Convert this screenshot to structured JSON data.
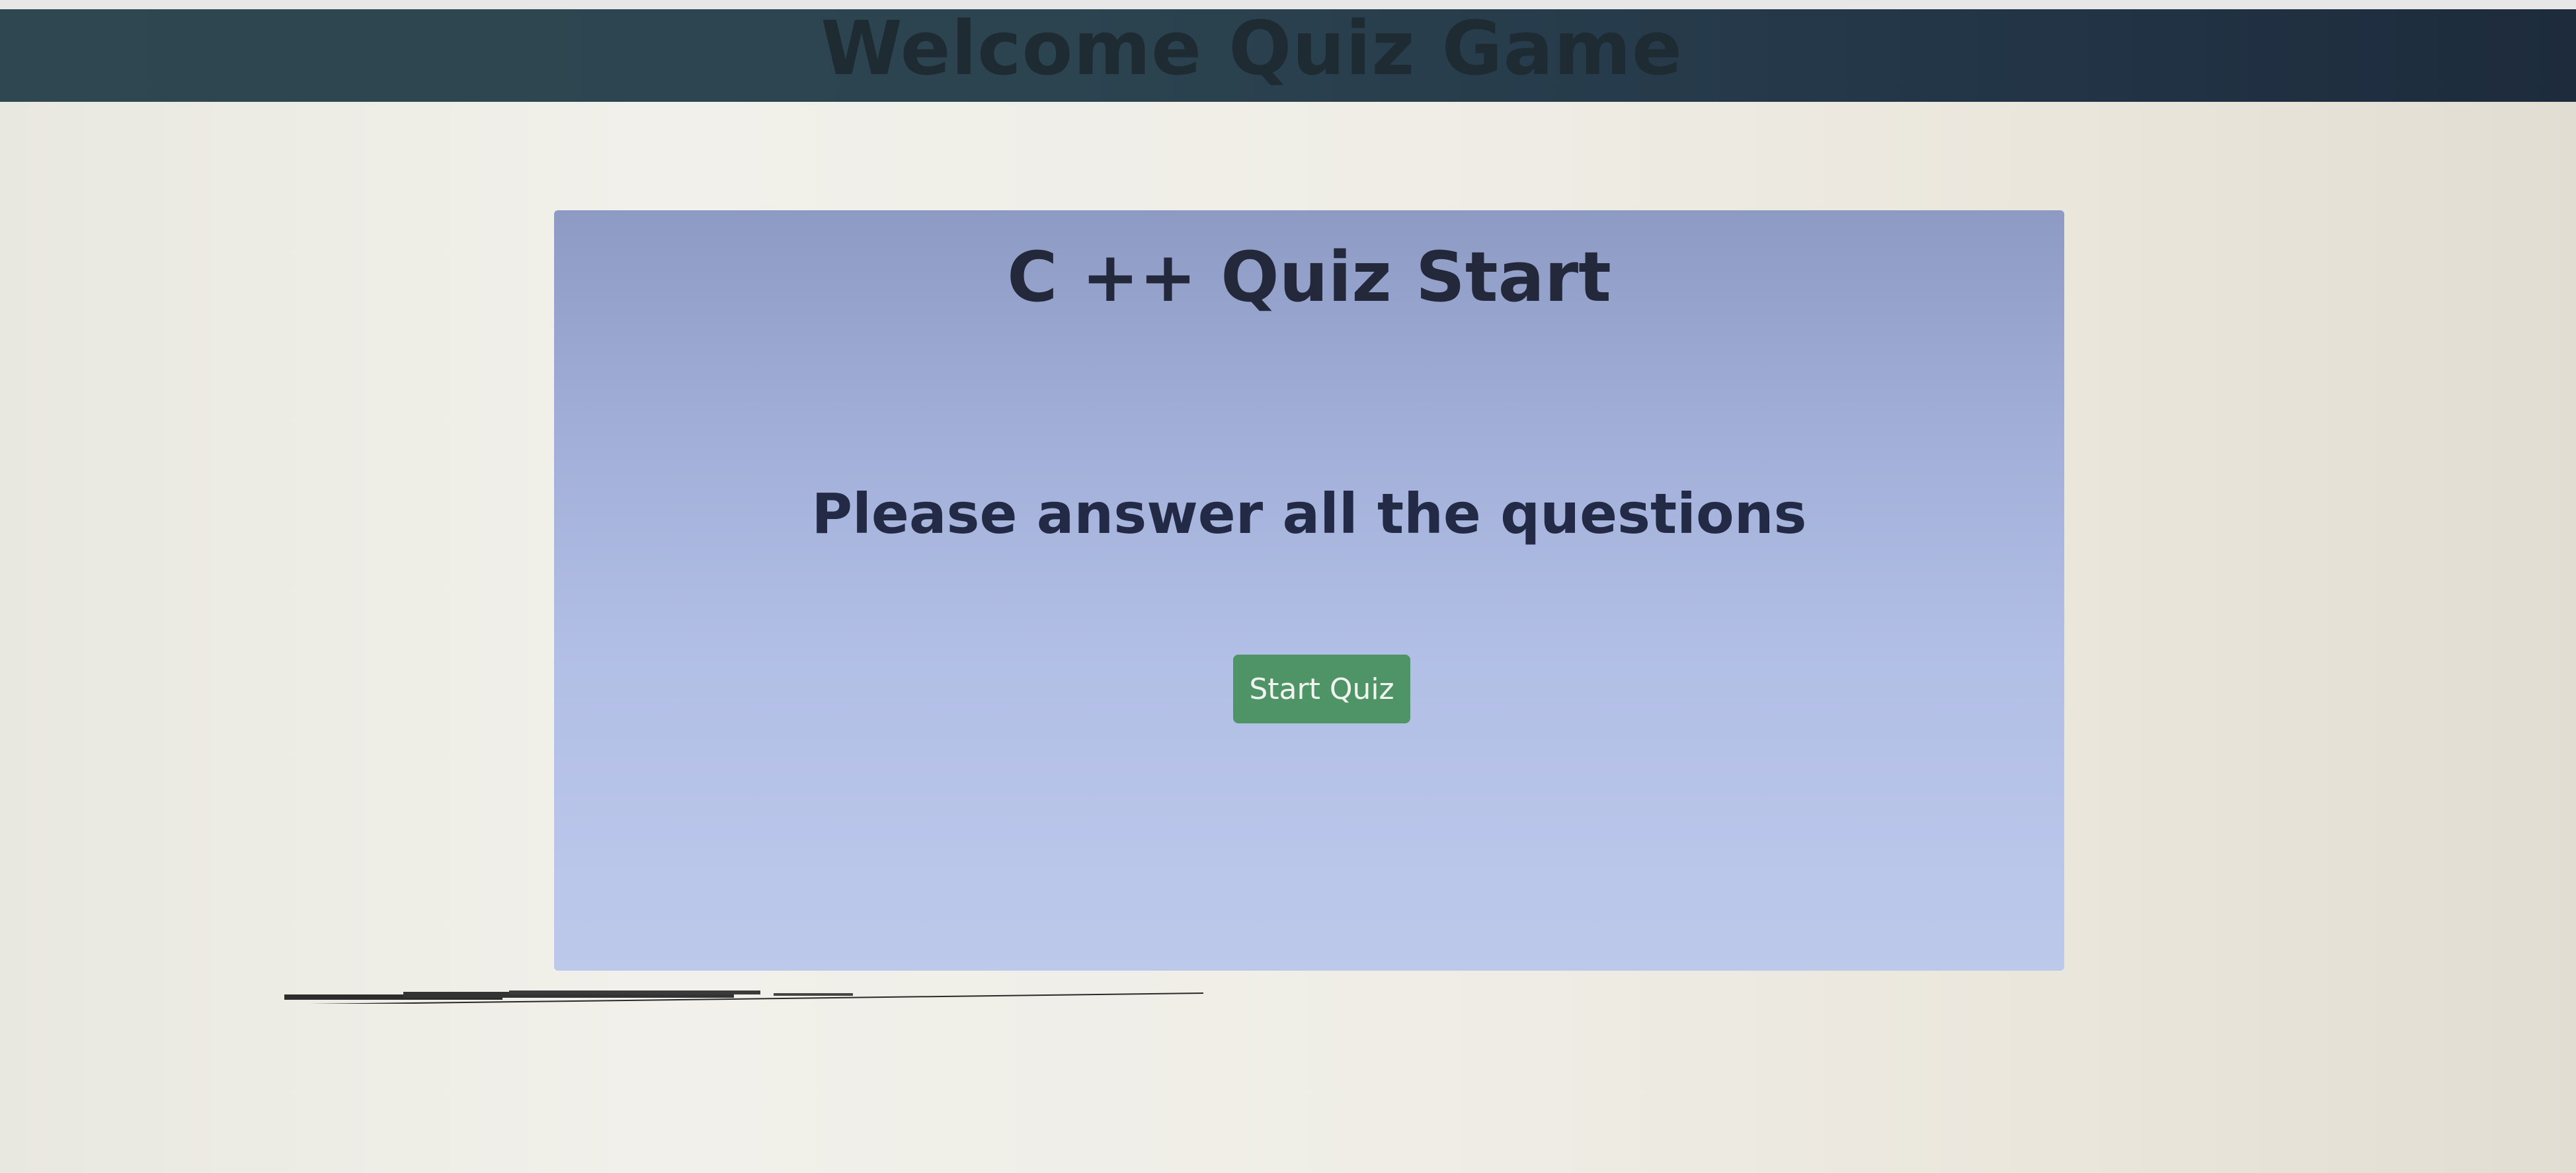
{
  "header": {
    "title": "Welcome Quiz Game",
    "background": "#2c4450"
  },
  "quiz_card": {
    "title": "C ++ Quiz Start",
    "instructions": "Please answer all the questions",
    "start_button_label": "Start Quiz",
    "background": "#a9b6de",
    "button_color": "#4f9466"
  }
}
